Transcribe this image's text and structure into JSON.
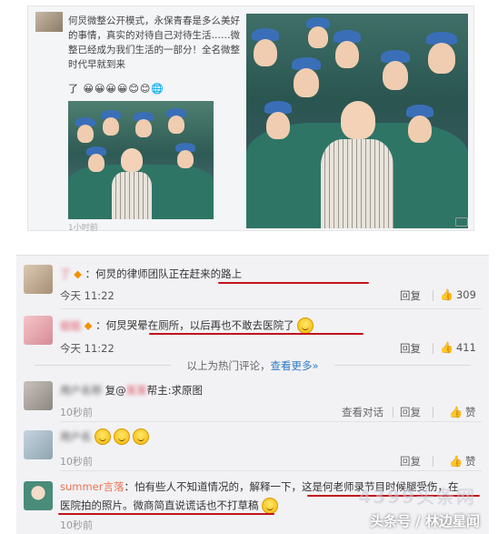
{
  "post": {
    "text": "何炅微整公开模式，永保青春是多么美好的事情，真实的对待自己对待生活……微整已经成为我们生活的一部分！全名微整时代早就到来",
    "emoji_prefix": "了",
    "timestamp": "1小时前"
  },
  "comments": [
    {
      "username": "了",
      "text": "何炅的律师团队正在赶来的路上",
      "time": "今天 11:22",
      "reply_label": "回复",
      "likes": "309"
    },
    {
      "username": "姐姐",
      "text": "何炅哭晕在厕所，以后再也不敢去医院了",
      "time": "今天 11:22",
      "reply_label": "回复",
      "likes": "411"
    }
  ],
  "hot_divider": {
    "text": "以上为热门评论，",
    "link": "查看更多»"
  },
  "recent": [
    {
      "text": "复@",
      "text2": "帮主:求原图",
      "time": "10秒前",
      "view_conversation": "查看对话",
      "reply_label": "回复",
      "like_label": "赞"
    },
    {
      "time": "10秒前",
      "reply_label": "回复",
      "like_label": "赞"
    },
    {
      "username": "summer言落",
      "text_a": "：怕有些人不知道情况的，解释一下，这是何老师录节目时候腿受伤，在",
      "text_b": "医院拍的照片。微商简直说谎话也不打草稿",
      "time": "10秒前"
    }
  ],
  "watermark": "头条号 / 林边星闻",
  "watermark_faint": "4399头条网",
  "colors": {
    "username": "#eb7350",
    "link": "#2e7bc4",
    "underline": "#c0141c",
    "comment_bg": "#f2f2f5"
  }
}
